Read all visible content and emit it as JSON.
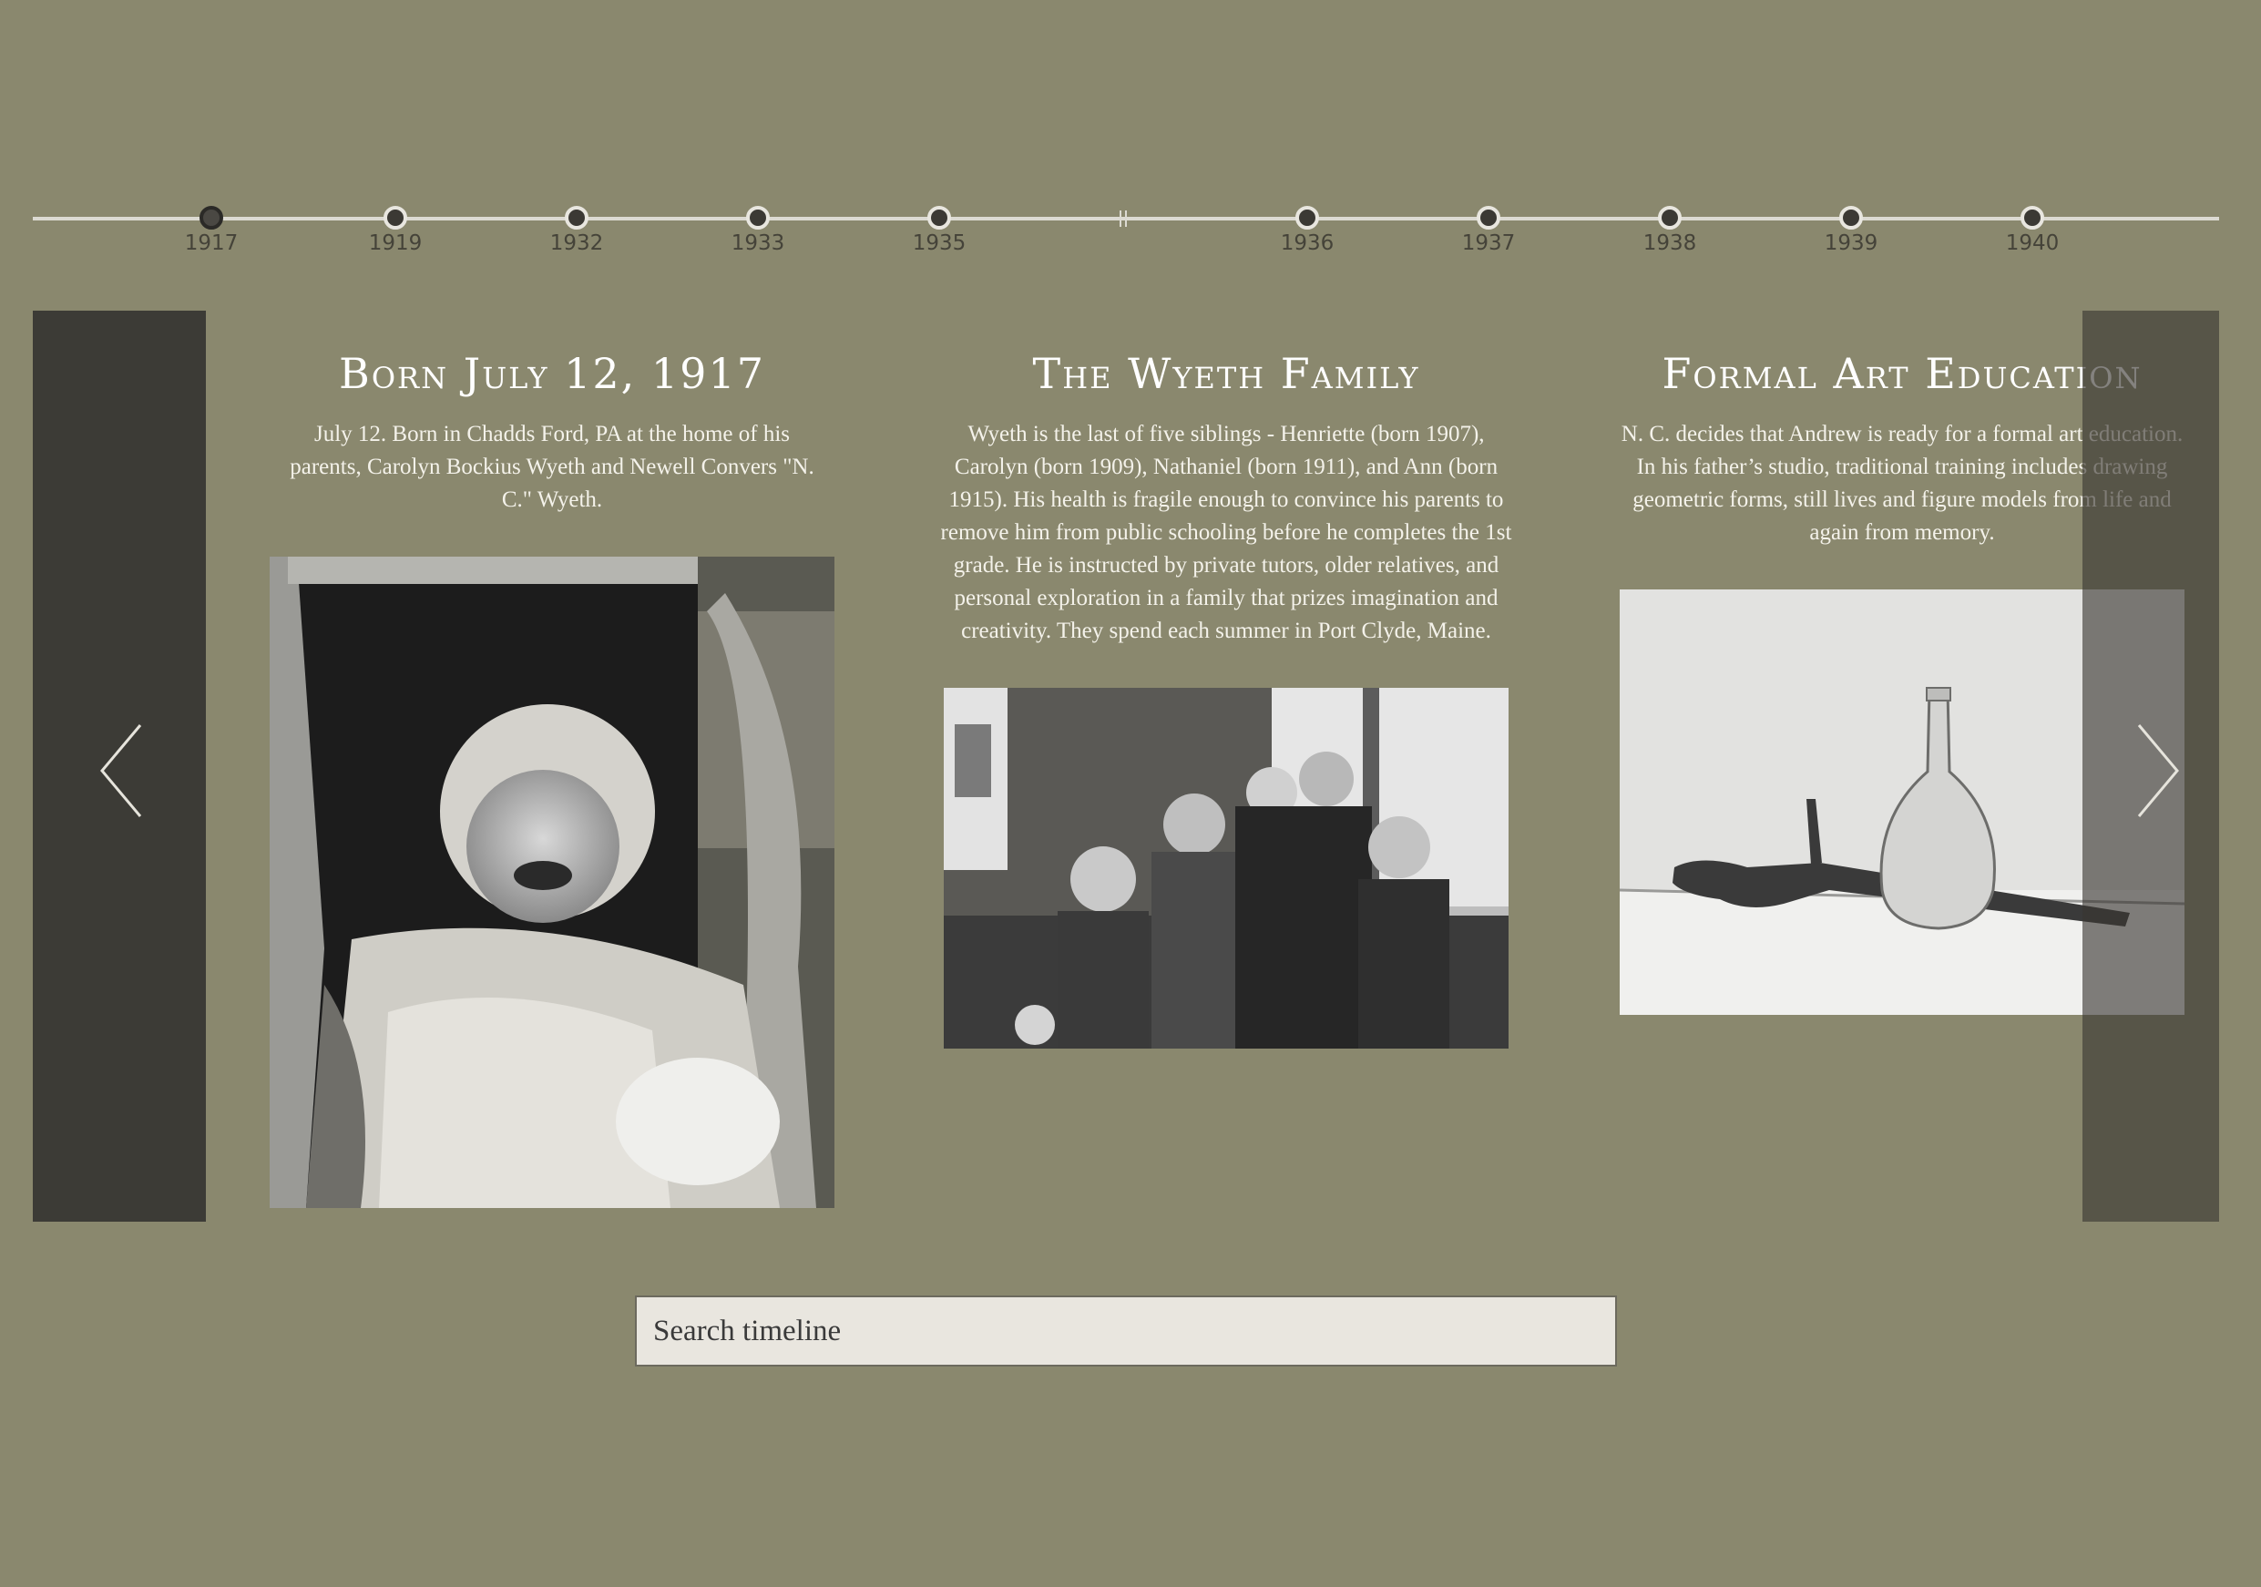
{
  "timeline": {
    "years": [
      "1917",
      "1919",
      "1932",
      "1933",
      "1935",
      "1936",
      "1937",
      "1938",
      "1939",
      "1940"
    ],
    "active_index": 0
  },
  "navigation": {
    "prev_icon": "chevron-left-icon",
    "next_icon": "chevron-right-icon"
  },
  "cards": [
    {
      "title": "Born July 12, 1917",
      "text": "July 12. Born in Chadds Ford, PA at the home of his parents, Carolyn Bockius Wyeth and Newell Convers \"N. C.\" Wyeth.",
      "image": "baby-in-wicker-carriage-photo"
    },
    {
      "title": "The Wyeth Family",
      "text": "Wyeth is the last of five siblings - Henriette (born 1907), Carolyn (born 1909), Nathaniel (born 1911), and Ann (born 1915). His health is fragile enough to convince his parents to remove him from public schooling before he completes the 1st grade. He is instructed by private tutors, older relatives, and personal exploration in a family that prizes imagination and creativity. They spend each summer in Port Clyde, Maine.",
      "image": "five-children-group-photo"
    },
    {
      "title": "Formal Art Education",
      "text": "N. C. decides that Andrew is ready for a formal art education. In his father’s studio, traditional training includes drawing geometric forms, still lives and figure models from life and again from memory.",
      "image": "pistol-and-bottle-still-life-drawing"
    }
  ],
  "search": {
    "placeholder": "Search timeline",
    "value": ""
  },
  "colors": {
    "background": "#8a886e",
    "panel_dark": "#3c3b36",
    "text_light": "#ffffff",
    "search_bg": "#e9e6df"
  }
}
